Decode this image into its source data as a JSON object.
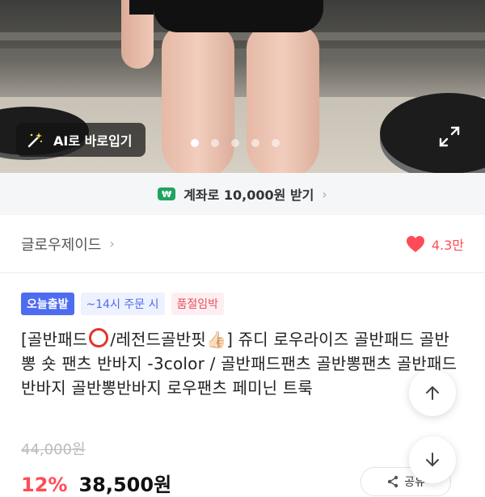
{
  "photo": {
    "ai_button_label": "AI로 바로입기",
    "ai_icon": "magic-wand-icon",
    "expand_icon": "expand-icon",
    "carousel": {
      "count": 5,
      "active_index": 0
    }
  },
  "account_banner": {
    "badge": "₩",
    "label": "계좌로 10,000원 받기",
    "chevron": "›"
  },
  "brand": {
    "name": "글로우제이드",
    "chevron": "›",
    "like_count": "4.3만",
    "like_icon": "heart-icon",
    "like_color": "#ff4b57"
  },
  "badges": {
    "today": "오늘출발",
    "time": "~14시 주문 시",
    "stock": "품절임박"
  },
  "title": {
    "part1": "[골반패드",
    "part2": "/레전드골반핏",
    "thumb": "👍🏻",
    "part3": "] 쥬디 로우라이즈 골반패드 골반뽕 숏 팬츠 반바지 -3color / 골반패드팬츠 골반뽕팬츠 골반패드반바지 골반뽕반바지 로우팬츠 페미닌 트룩"
  },
  "price": {
    "original": "44,000원",
    "discount": "12%",
    "current": "38,500원",
    "share_label": "공유"
  },
  "colors": {
    "accent_red": "#ff4b57",
    "badge_blue": "#4d6cf0",
    "account_green": "#1fa35f"
  }
}
